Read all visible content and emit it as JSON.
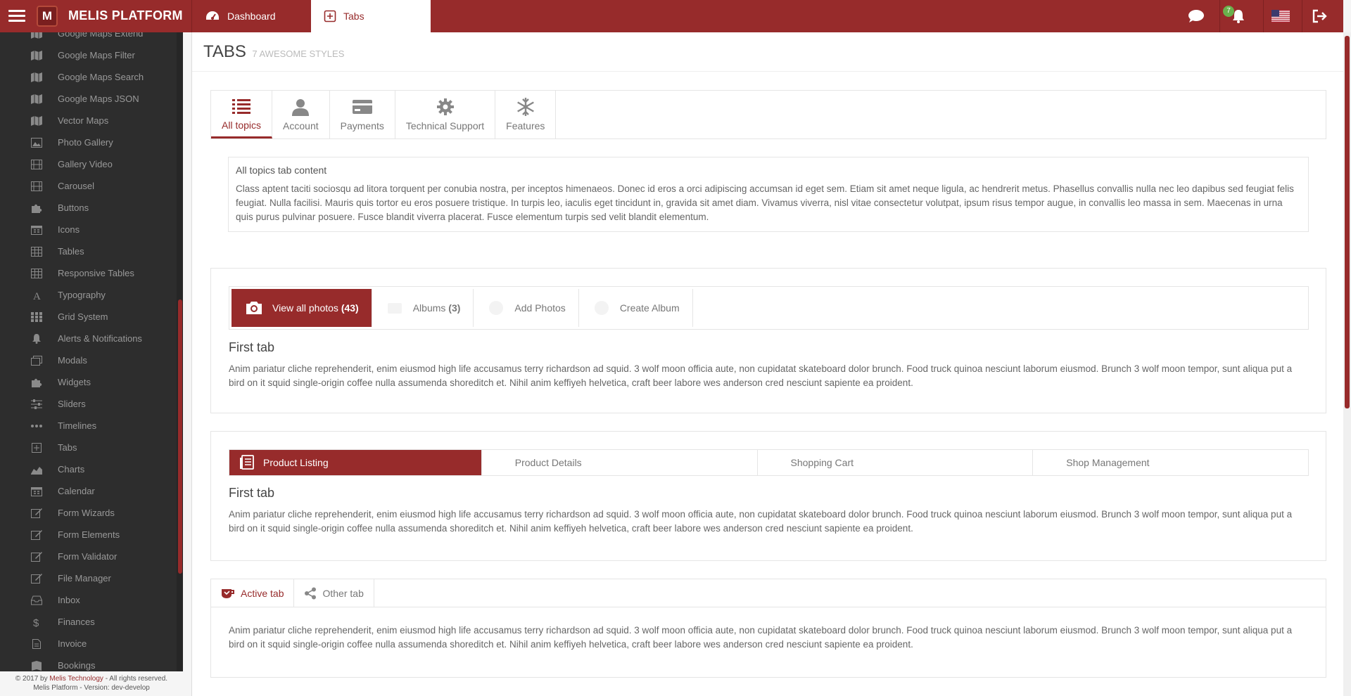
{
  "topbar": {
    "brand": "MELIS PLATFORM",
    "logo_letter": "M",
    "tabs": [
      {
        "label": "Dashboard",
        "icon": "dashboard-icon"
      },
      {
        "label": "Tabs",
        "icon": "plus-square-icon"
      }
    ],
    "notification_count": "7",
    "icons": [
      "chat-icon",
      "bell-icon",
      "us-flag-icon",
      "logout-icon"
    ]
  },
  "sidebar": {
    "items": [
      {
        "label": "Google Maps Extend",
        "icon": "map-icon"
      },
      {
        "label": "Google Maps Filter",
        "icon": "map-icon"
      },
      {
        "label": "Google Maps Search",
        "icon": "map-icon"
      },
      {
        "label": "Google Maps JSON",
        "icon": "map-icon"
      },
      {
        "label": "Vector Maps",
        "icon": "map-icon"
      },
      {
        "label": "Photo Gallery",
        "icon": "picture-icon"
      },
      {
        "label": "Gallery Video",
        "icon": "film-icon"
      },
      {
        "label": "Carousel",
        "icon": "film-icon"
      },
      {
        "label": "Buttons",
        "icon": "puzzle-icon"
      },
      {
        "label": "Icons",
        "icon": "calendar-icon"
      },
      {
        "label": "Tables",
        "icon": "table-icon"
      },
      {
        "label": "Responsive Tables",
        "icon": "table-icon"
      },
      {
        "label": "Typography",
        "icon": "typography-icon"
      },
      {
        "label": "Grid System",
        "icon": "grid-icon"
      },
      {
        "label": "Alerts & Notifications",
        "icon": "bell-icon"
      },
      {
        "label": "Modals",
        "icon": "window-icon"
      },
      {
        "label": "Widgets",
        "icon": "puzzle-icon"
      },
      {
        "label": "Sliders",
        "icon": "sliders-icon"
      },
      {
        "label": "Timelines",
        "icon": "ellipsis-icon"
      },
      {
        "label": "Tabs",
        "icon": "plus-square-icon"
      },
      {
        "label": "Charts",
        "icon": "area-chart-icon"
      },
      {
        "label": "Calendar",
        "icon": "calendar-icon"
      },
      {
        "label": "Form Wizards",
        "icon": "edit-icon"
      },
      {
        "label": "Form Elements",
        "icon": "edit-icon"
      },
      {
        "label": "Form Validator",
        "icon": "edit-icon"
      },
      {
        "label": "File Manager",
        "icon": "edit-icon"
      },
      {
        "label": "Inbox",
        "icon": "inbox-icon"
      },
      {
        "label": "Finances",
        "icon": "dollar-icon"
      },
      {
        "label": "Invoice",
        "icon": "file-icon"
      },
      {
        "label": "Bookings",
        "icon": "book-icon"
      }
    ],
    "footer_line1_pre": "© 2017 by ",
    "footer_line1_link": "Melis Technology",
    "footer_line1_post": " - All rights reserved.",
    "footer_line2": "Melis Platform - Version: dev-develop"
  },
  "page": {
    "title": "TABS",
    "subtitle": "7 AWESOME STYLES"
  },
  "widget1": {
    "tabs": [
      {
        "label": "All topics",
        "icon": "list-icon",
        "active": true
      },
      {
        "label": "Account",
        "icon": "user-icon"
      },
      {
        "label": "Payments",
        "icon": "credit-card-icon"
      },
      {
        "label": "Technical Support",
        "icon": "gear-icon"
      },
      {
        "label": "Features",
        "icon": "snowflake-icon"
      }
    ],
    "content_heading": "All topics tab content",
    "content_body": "Class aptent taciti sociosqu ad litora torquent per conubia nostra, per inceptos himenaeos. Donec id eros a orci adipiscing accumsan id eget sem. Etiam sit amet neque ligula, ac hendrerit metus. Phasellus convallis nulla nec leo dapibus sed feugiat felis feugiat. Nulla facilisi. Mauris quis tortor eu eros posuere tristique. In turpis leo, iaculis eget tincidunt in, gravida sit amet diam. Vivamus viverra, nisl vitae consectetur volutpat, ipsum risus tempor augue, in convallis leo massa in sem. Maecenas in urna quis purus pulvinar posuere. Fusce blandit viverra placerat. Fusce elementum turpis sed velit blandit elementum."
  },
  "widget2": {
    "tabs": [
      {
        "label": "View all photos",
        "count": "(43)",
        "icon": "camera-icon",
        "active": true
      },
      {
        "label": "Albums",
        "count": "(3)",
        "icon": "album-icon"
      },
      {
        "label": "Add Photos",
        "count": "",
        "icon": "add-photo-icon"
      },
      {
        "label": "Create Album",
        "count": "",
        "icon": "create-album-icon"
      }
    ],
    "heading": "First tab",
    "body": "Anim pariatur cliche reprehenderit, enim eiusmod high life accusamus terry richardson ad squid. 3 wolf moon officia aute, non cupidatat skateboard dolor brunch. Food truck quinoa nesciunt laborum eiusmod. Brunch 3 wolf moon tempor, sunt aliqua put a bird on it squid single-origin coffee nulla assumenda shoreditch et. Nihil anim keffiyeh helvetica, craft beer labore wes anderson cred nesciunt sapiente ea proident."
  },
  "widget3": {
    "tabs": [
      {
        "label": "Product Listing",
        "icon": "document-icon",
        "active": true
      },
      {
        "label": "Product Details"
      },
      {
        "label": "Shopping Cart"
      },
      {
        "label": "Shop Management"
      }
    ],
    "heading": "First tab",
    "body": "Anim pariatur cliche reprehenderit, enim eiusmod high life accusamus terry richardson ad squid. 3 wolf moon officia aute, non cupidatat skateboard dolor brunch. Food truck quinoa nesciunt laborum eiusmod. Brunch 3 wolf moon tempor, sunt aliqua put a bird on it squid single-origin coffee nulla assumenda shoreditch et. Nihil anim keffiyeh helvetica, craft beer labore wes anderson cred nesciunt sapiente ea proident."
  },
  "widget4": {
    "tabs": [
      {
        "label": "Active tab",
        "icon": "coffee-icon",
        "active": true
      },
      {
        "label": "Other tab",
        "icon": "share-icon"
      }
    ],
    "body": "Anim pariatur cliche reprehenderit, enim eiusmod high life accusamus terry richardson ad squid. 3 wolf moon officia aute, non cupidatat skateboard dolor brunch. Food truck quinoa nesciunt laborum eiusmod. Brunch 3 wolf moon tempor, sunt aliqua put a bird on it squid single-origin coffee nulla assumenda shoreditch et. Nihil anim keffiyeh helvetica, craft beer labore wes anderson cred nesciunt sapiente ea proident."
  },
  "colors": {
    "brand": "#972b2b",
    "sidebar_bg": "#2d2d2d",
    "badge": "#6ab04c"
  }
}
